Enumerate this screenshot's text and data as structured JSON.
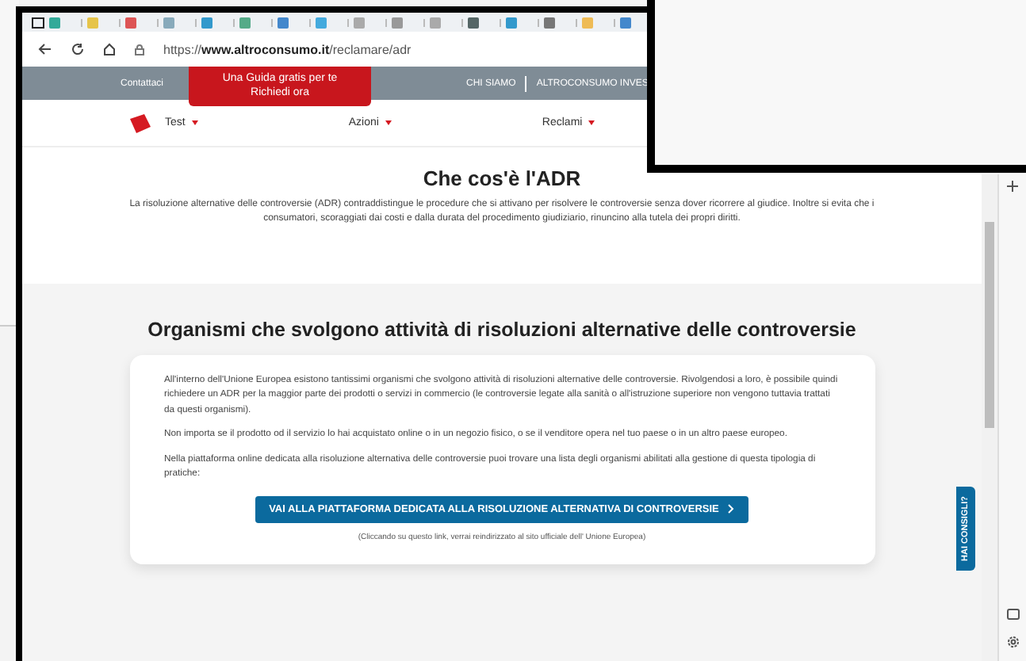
{
  "browser": {
    "url_prefix": "https://",
    "url_domain": "www.altroconsumo.it",
    "url_path": "/reclamare/adr"
  },
  "topbar": {
    "contact": "Contattaci",
    "promo_lines": [
      "Una Guida gratis per te",
      "Richiedi ora"
    ],
    "links": [
      "CHI SIAMO",
      "ALTROCONSUMO INVES"
    ]
  },
  "nav": [
    {
      "label": "Test"
    },
    {
      "label": "Azioni"
    },
    {
      "label": "Reclami"
    }
  ],
  "intro": {
    "title": "Che cos'è l'ADR",
    "text": "La risoluzione alternative delle controversie (ADR) contraddistingue le procedure che si attivano per risolvere le controversie senza dover ricorrere al giudice. Inoltre si evita che i consumatori, scoraggiati dai costi e dalla durata del procedimento giudiziario, rinuncino alla tutela dei propri diritti."
  },
  "section": {
    "title": "Organismi che svolgono attività di risoluzioni alternative delle controversie",
    "paragraphs": [
      "All'interno dell'Unione Europea esistono tantissimi organismi che svolgono attività di risoluzioni alternative delle controversie. Rivolgendosi a loro, è possibile quindi richiedere un ADR per la maggior parte dei prodotti o servizi in commercio (le controversie legate alla sanità o all'istruzione superiore non vengono tuttavia trattati da questi organismi).",
      "Non importa se il prodotto od il servizio lo hai acquistato online o in un negozio fisico, o se il venditore opera nel tuo paese o in un altro paese europeo.",
      "Nella piattaforma online dedicata alla risoluzione alternativa delle controversie puoi trovare una lista degli organismi abilitati alla gestione di questa tipologia di pratiche:"
    ],
    "button": "VAI ALLA PIATTAFORMA DEDICATA ALLA RISOLUZIONE ALTERNATIVA DI CONTROVERSIE",
    "note": "(Cliccando su questo link, verrai reindirizzato al sito ufficiale dell' Unione Europea)"
  },
  "side_tab": "HAI CONSIGLI?"
}
